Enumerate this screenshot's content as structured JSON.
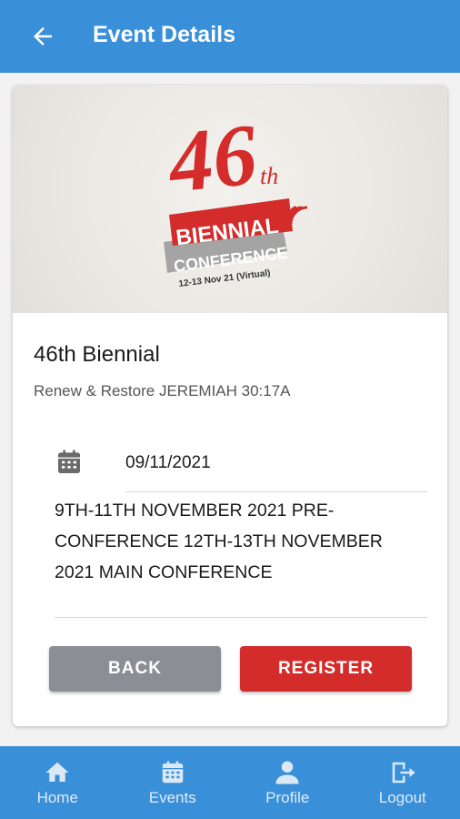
{
  "header": {
    "title": "Event Details",
    "icon": "arrow-left-icon"
  },
  "banner": {
    "number": "46",
    "suffix": "th",
    "ribbon_main": "BIENNIAL",
    "ribbon_sub": "CONFERENCE",
    "dates": "12-13 Nov 21 (Virtual)",
    "colors": {
      "red": "#d42b2b",
      "grey": "#9a9a9a"
    }
  },
  "event": {
    "title": "46th Biennial",
    "subtitle": "Renew & Restore JEREMIAH 30:17A",
    "date": "09/11/2021",
    "description": "9TH-11TH NOVEMBER 2021 PRE-CONFERENCE 12TH-13TH NOVEMBER 2021 MAIN CONFERENCE"
  },
  "actions": {
    "back_label": "BACK",
    "register_label": "REGISTER"
  },
  "nav": {
    "items": [
      {
        "label": "Home",
        "icon": "home-icon"
      },
      {
        "label": "Events",
        "icon": "calendar-icon"
      },
      {
        "label": "Profile",
        "icon": "person-icon"
      },
      {
        "label": "Logout",
        "icon": "logout-icon"
      }
    ]
  },
  "colors": {
    "primary": "#3a8fd9",
    "accent": "#d42b2b",
    "secondary_button": "#8c8e96"
  }
}
